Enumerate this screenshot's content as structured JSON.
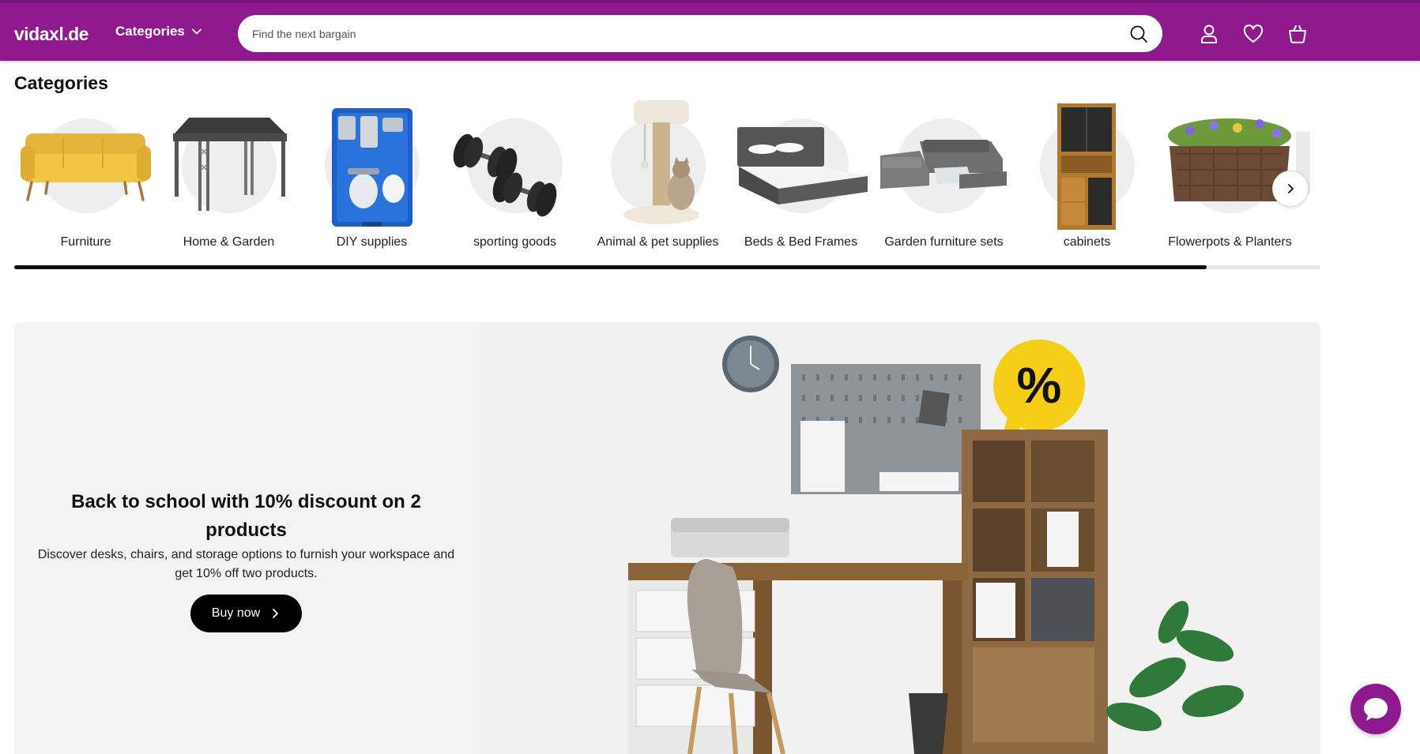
{
  "header": {
    "logo_text": "vidaxl.de",
    "categories_label": "Categories",
    "search_placeholder": "Find the next bargain",
    "icons": [
      "search-icon",
      "user-icon",
      "heart-icon",
      "cart-icon"
    ]
  },
  "categories": {
    "title": "Categories",
    "items": [
      {
        "label": "Furniture",
        "icon": "sofa"
      },
      {
        "label": "Home & Garden",
        "icon": "gazebo"
      },
      {
        "label": "DIY supplies",
        "icon": "tool-case"
      },
      {
        "label": "sporting goods",
        "icon": "dumbbells"
      },
      {
        "label": "Animal & pet supplies",
        "icon": "cat-tree"
      },
      {
        "label": "Beds & Bed Frames",
        "icon": "bed"
      },
      {
        "label": "Garden furniture sets",
        "icon": "lounge-set"
      },
      {
        "label": "cabinets",
        "icon": "cabinet"
      },
      {
        "label": "Flowerpots & Planters",
        "icon": "planter"
      }
    ],
    "scroll_progress": 0.913
  },
  "banner": {
    "title": "Back to school with 10% discount on 2 products",
    "description": "Discover desks, chairs, and storage options to furnish your workspace and get 10% off two products.",
    "button_label": "Buy now",
    "badge_text": "%"
  },
  "colors": {
    "brand": "#8e1a8e",
    "button": "#000000",
    "banner_bg": "#f3f3f3"
  }
}
